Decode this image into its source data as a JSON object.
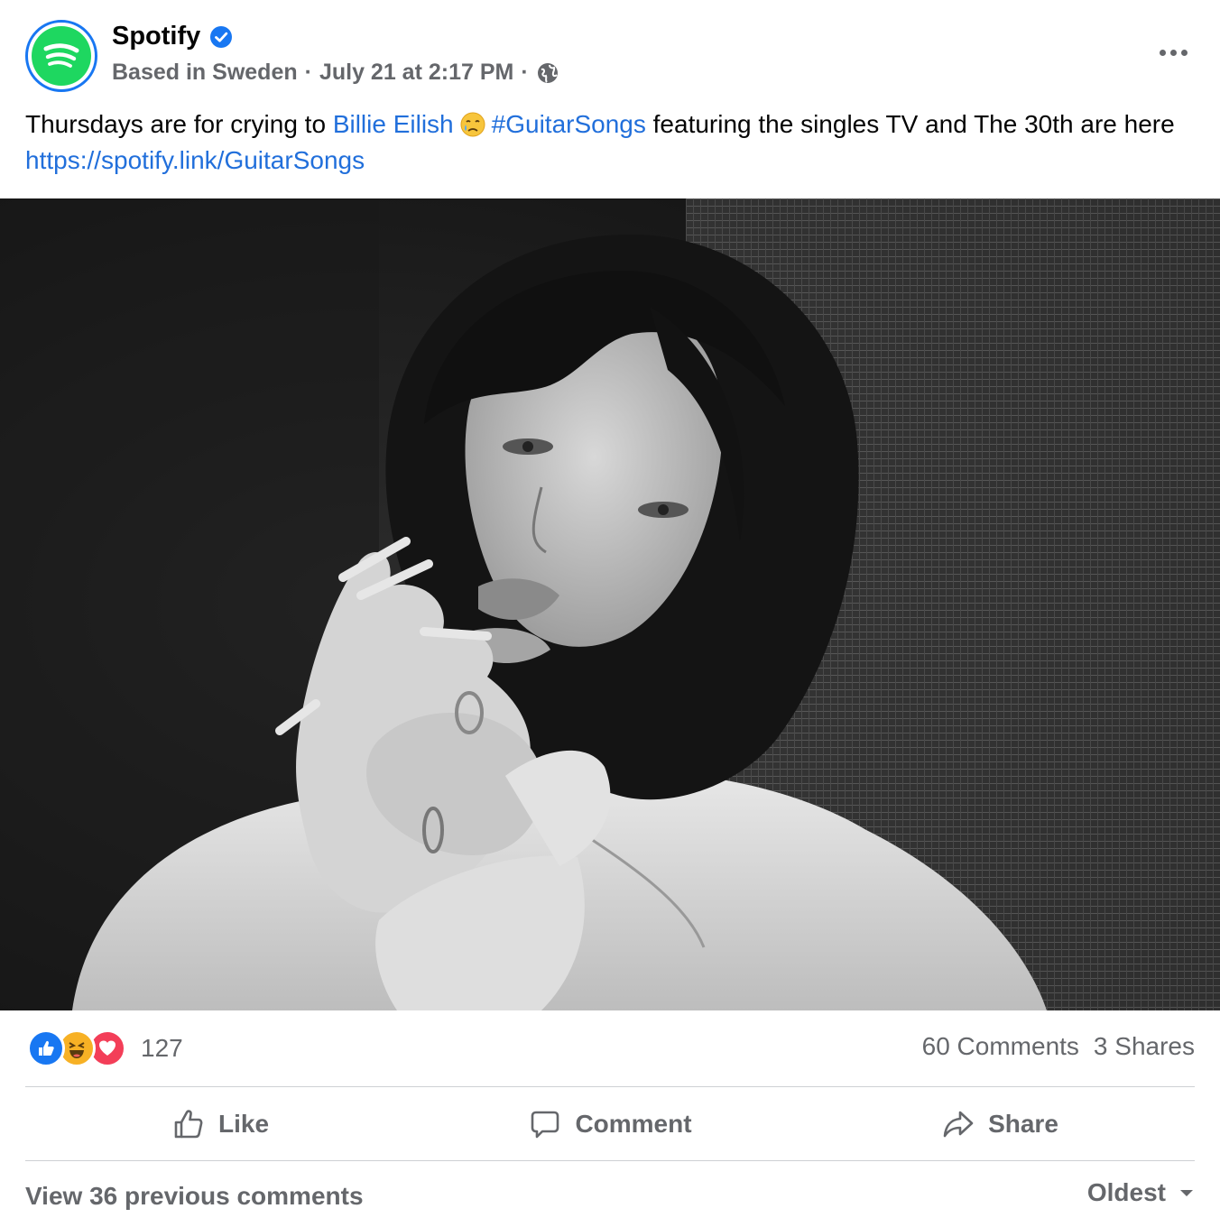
{
  "post": {
    "page_name": "Spotify",
    "verified": true,
    "meta": {
      "location": "Based in Sweden",
      "separator": "·",
      "timestamp": "July 21 at 2:17 PM",
      "privacy_icon": "globe-icon"
    },
    "text": {
      "part1": "Thursdays are for crying to ",
      "mention": "Billie Eilish",
      "emoji": "crying-face-emoji",
      "hashtag": "#GuitarSongs",
      "part2": " featuring the singles TV and The 30th are here ",
      "url": "https://spotify.link/GuitarSongs"
    },
    "image_alt": "Black and white portrait photo"
  },
  "reactions": {
    "types": [
      "like",
      "haha",
      "love"
    ],
    "count": "127"
  },
  "counts": {
    "comments": "60 Comments",
    "shares": "3 Shares"
  },
  "actions": {
    "like": "Like",
    "comment": "Comment",
    "share": "Share"
  },
  "comments_footer": {
    "view_previous": "View 36 previous comments",
    "sort_label": "Oldest"
  },
  "colors": {
    "link": "#216fdb",
    "secondary_text": "#65676b",
    "spotify_green": "#1ed760",
    "facebook_blue": "#1877f2"
  }
}
